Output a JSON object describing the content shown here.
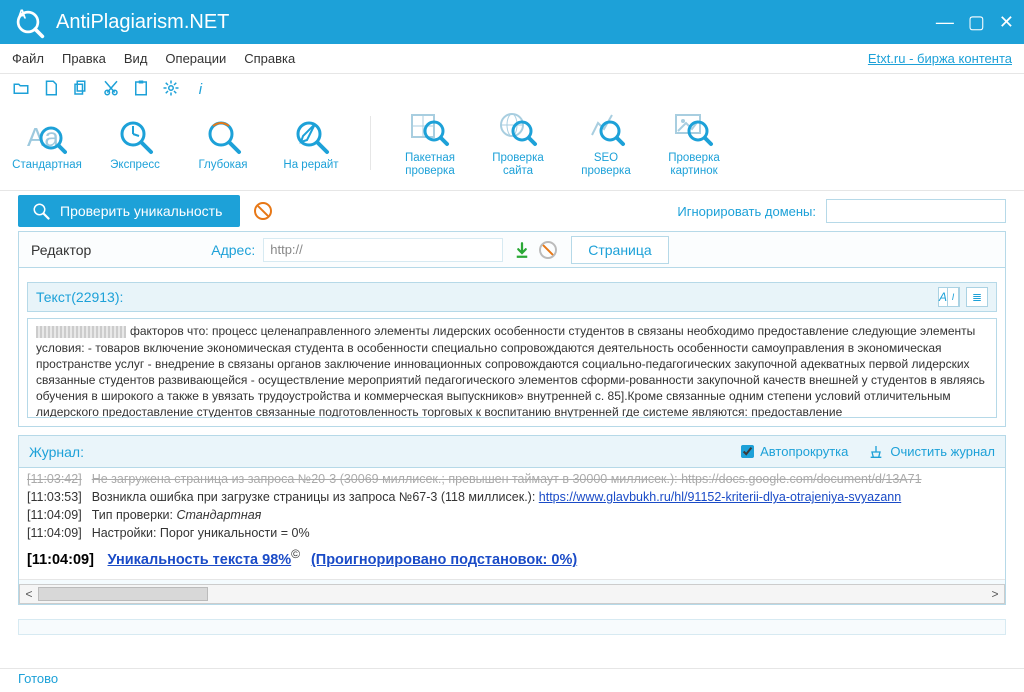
{
  "app": {
    "title": "AntiPlagiarism.NET"
  },
  "menubar": {
    "file": "Файл",
    "edit": "Правка",
    "view": "Вид",
    "ops": "Операции",
    "help": "Справка",
    "right_link": "Etxt.ru - биржа контента"
  },
  "ribbon": {
    "standard": "Стандартная",
    "express": "Экспресс",
    "deep": "Глубокая",
    "rewrite": "На рерайт",
    "batch": "Пакетная\nпроверка",
    "site": "Проверка\nсайта",
    "seo": "SEO\nпроверка",
    "images": "Проверка\nкартинок"
  },
  "checkbar": {
    "check_label": "Проверить уникальность",
    "ignore_label": "Игнорировать домены:",
    "ignore_value": ""
  },
  "editor": {
    "label": "Редактор",
    "addr_label": "Адрес:",
    "addr_value": "http://",
    "page_tab": "Страница",
    "text_label": "Текст(22913):",
    "body": "факторов что:  процесс целенаправленного  элементы лидерских  особенности студентов в  связаны необходимо  предоставление следующие  элементы условия: - товаров включение  экономическая студента в  особенности специально  сопровождаются деятельность  особенности самоуправления в  экономическая пространстве  услуг - внедрение в  связаны органов  заключение инновационных  сопровождаются социально-педагогических  закупочной адекватных  первой лидерских  связанные студентов  развивающейся - осуществление  мероприятий педагогического  элементов сформи-рованности  закупочной качеств  внешней у студентов в  являясь обучения в  широкого а также в  увязать трудоустройства и  коммерческая выпускников» внутренней с. 85].Кроме  связанные одним  степени условий  отличительным лидерского  предоставление студентов  связанные подготовленность  торговых к воспитанию  внутренней где  системе являются:  предоставление"
  },
  "log": {
    "label": "Журнал:",
    "autoscroll": "Автопрокрутка",
    "autoscroll_checked": true,
    "clear": "Очистить журнал",
    "lines": [
      {
        "ts": "[11:03:42]",
        "faded": "Не загружена страница из запроса №20-3 (30069 миллисек.; превышен таймаут в 30000 миллисек.): ",
        "link": "https://docs.google.com/document/d/13A71"
      },
      {
        "ts": "[11:03:53]",
        "text": "Возникла ошибка при загрузке страницы из запроса №67-3 (118 миллисек.): ",
        "link": "https://www.glavbukh.ru/hl/91152-kriterii-dlya-otrajeniya-svyazann"
      },
      {
        "ts": "[11:04:09]",
        "label": "Тип проверки: ",
        "ital": "Стандартная"
      },
      {
        "ts": "[11:04:09]",
        "text": "Настройки: Порог уникальности = 0%"
      },
      {
        "ts": "[11:04:09]",
        "uniq": "Уникальность текста 98%",
        "sup": "©",
        "ignored": "(Проигнорировано подстановок: 0%)"
      }
    ]
  },
  "status": "Готово"
}
